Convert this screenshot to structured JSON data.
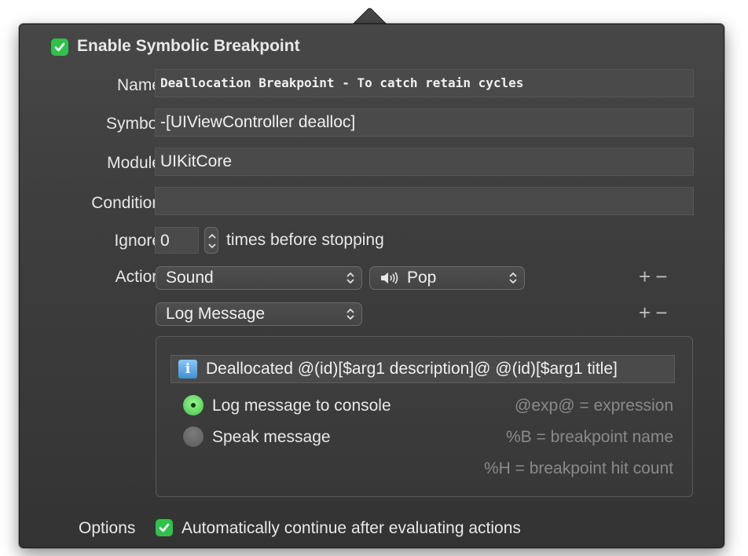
{
  "enable": {
    "label": "Enable Symbolic Breakpoint",
    "checked": true
  },
  "fields": {
    "name": {
      "label": "Name",
      "value": "Deallocation Breakpoint - To catch retain cycles"
    },
    "symbol": {
      "label": "Symbol",
      "value": "-[UIViewController dealloc]"
    },
    "module": {
      "label": "Module",
      "value": "UIKitCore"
    },
    "condition": {
      "label": "Condition",
      "value": ""
    }
  },
  "ignore": {
    "label": "Ignore",
    "value": "0",
    "suffix": "times before stopping"
  },
  "actions": {
    "label": "Action",
    "items": [
      {
        "type": "Sound",
        "sound": "Pop",
        "sound_icon": "speaker-icon"
      },
      {
        "type": "Log Message"
      }
    ],
    "add": "+",
    "remove": "−"
  },
  "log_message": {
    "icon": "info-icon",
    "icon_glyph": "i",
    "text": "Deallocated @(id)[$arg1 description]@ @(id)[$arg1 title]",
    "options": [
      {
        "label": "Log message to console",
        "selected": true
      },
      {
        "label": "Speak message",
        "selected": false
      }
    ],
    "hints": [
      "@exp@ = expression",
      "%B = breakpoint name",
      "%H = breakpoint hit count"
    ]
  },
  "options": {
    "label": "Options",
    "auto_continue": {
      "label": "Automatically continue after evaluating actions",
      "checked": true
    }
  },
  "colors": {
    "accent": "#2fc24a",
    "background": "#3e3e3e",
    "field": "#4a4a4a"
  }
}
